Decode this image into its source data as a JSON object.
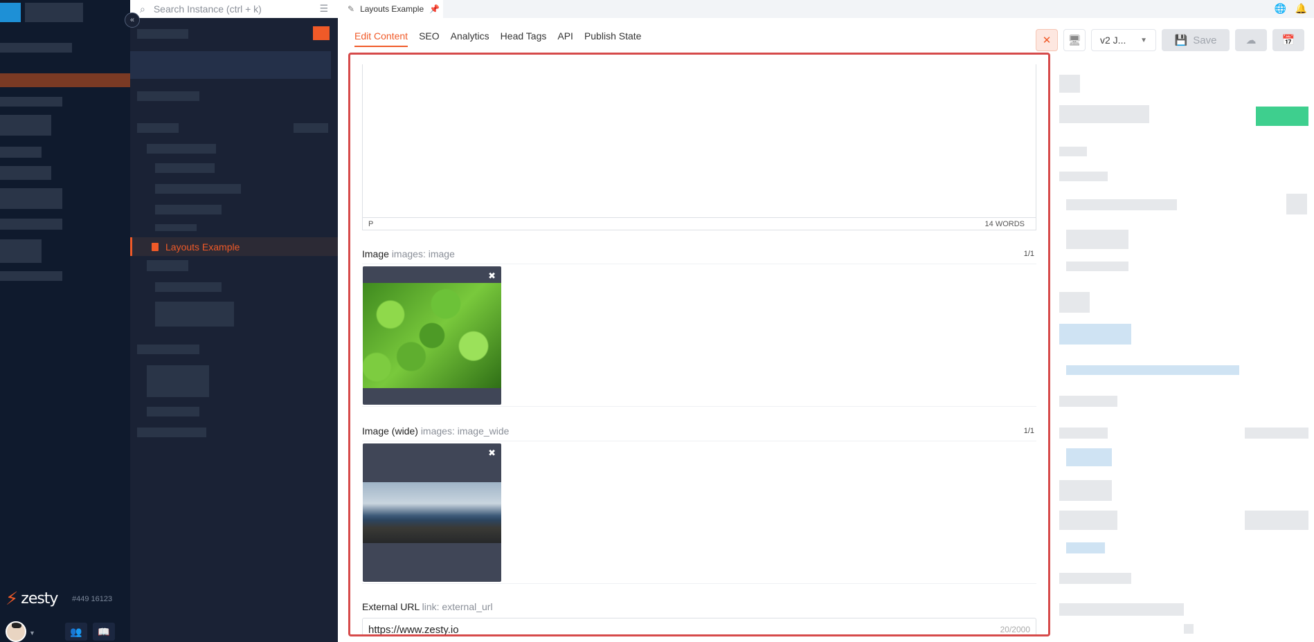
{
  "search": {
    "placeholder": "Search Instance (ctrl + k)"
  },
  "tab": {
    "label": "Layouts Example"
  },
  "tree": {
    "active_item": "Layouts Example"
  },
  "brand": {
    "name": "zesty",
    "instance_id": "#449 16123"
  },
  "subnav": {
    "items": [
      "Edit Content",
      "SEO",
      "Analytics",
      "Head Tags",
      "API",
      "Publish State"
    ],
    "active": "Edit Content"
  },
  "actions": {
    "version": "v2 J...",
    "save": "Save"
  },
  "editor": {
    "rte": {
      "path": "P",
      "word_count": "14 WORDS"
    },
    "image_field": {
      "label": "Image",
      "sub": "images: image",
      "count": "1/1"
    },
    "image_wide_field": {
      "label": "Image (wide)",
      "sub": "images: image_wide",
      "count": "1/1"
    },
    "external_url_field": {
      "label": "External URL",
      "sub": "link: external_url",
      "value": "https://www.zesty.io",
      "chars": "20/2000"
    }
  },
  "colors": {
    "accent": "#f05a28",
    "nav_bg": "#0f1a2d",
    "tree_bg": "#1a2235",
    "highlight_border": "#d64a4a"
  }
}
